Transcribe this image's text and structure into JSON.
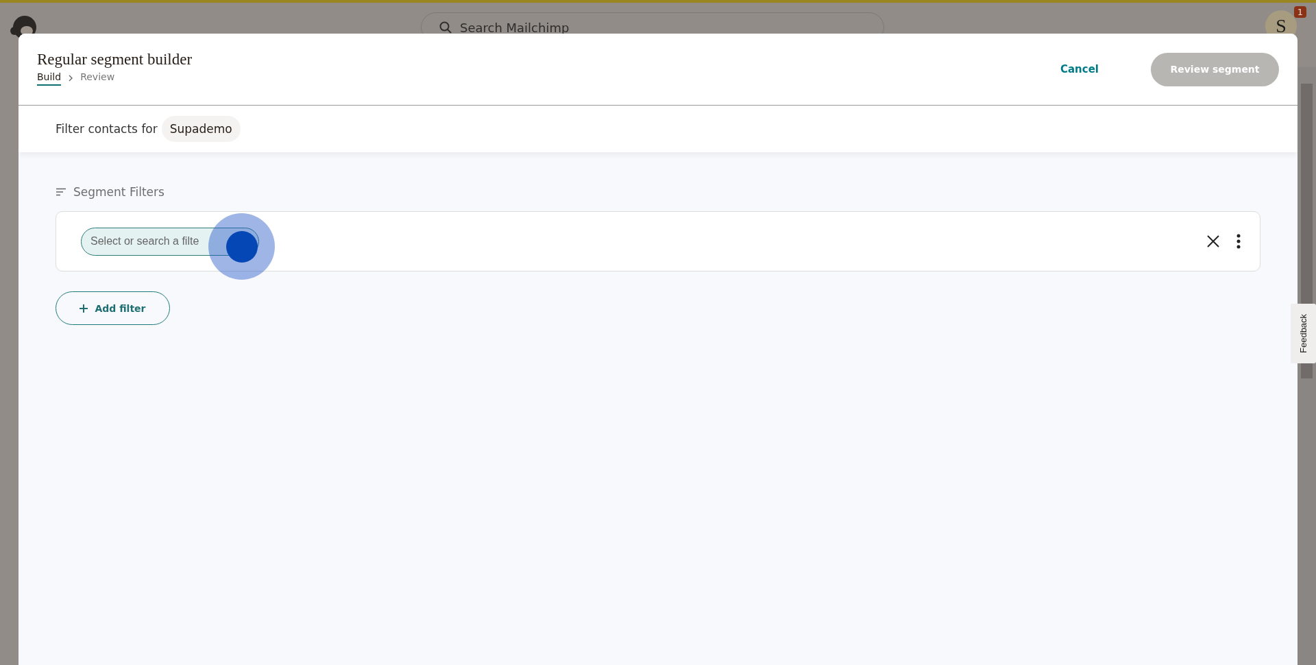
{
  "app_header": {
    "search": {
      "placeholder": "Search Mailchimp"
    },
    "avatar": {
      "initial": "S",
      "badge": "1"
    }
  },
  "modal": {
    "title": "Regular segment builder",
    "steps": [
      {
        "label": "Build",
        "selected": true
      },
      {
        "label": "Review",
        "selected": false
      }
    ],
    "actions": {
      "cancel": "Cancel",
      "submit": {
        "label": "Review segment",
        "disabled": true
      }
    },
    "audience": {
      "label": "Filter contacts for",
      "name": "Supademo"
    },
    "section_title": "Segment Filters",
    "filters": [
      {
        "placeholder": "Select or search a filte",
        "focused": true
      }
    ],
    "add_filter": "Add filter"
  },
  "feedback_tab": "Feedback"
}
